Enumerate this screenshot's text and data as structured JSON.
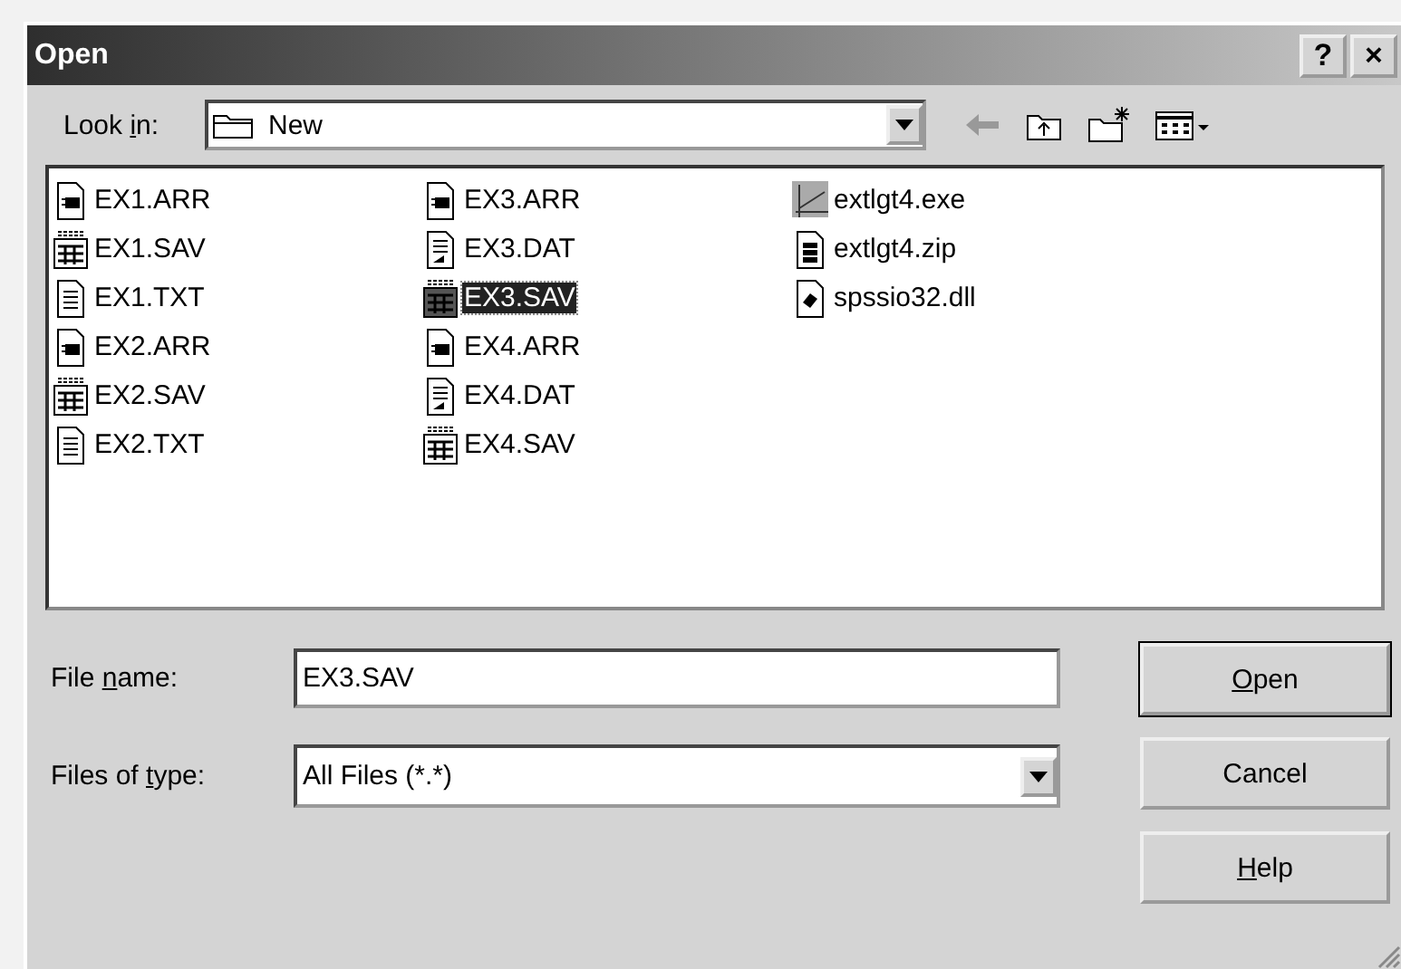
{
  "window": {
    "title": "Open",
    "help_glyph": "?",
    "close_glyph": "×"
  },
  "look_in": {
    "label": {
      "before": "Look ",
      "key": "i",
      "after": "n:"
    },
    "value": "New"
  },
  "files": [
    {
      "name": "EX1.ARR",
      "kind": "arr",
      "selected": false
    },
    {
      "name": "EX1.SAV",
      "kind": "sav",
      "selected": false
    },
    {
      "name": "EX1.TXT",
      "kind": "txt",
      "selected": false
    },
    {
      "name": "EX2.ARR",
      "kind": "arr",
      "selected": false
    },
    {
      "name": "EX2.SAV",
      "kind": "sav",
      "selected": false
    },
    {
      "name": "EX2.TXT",
      "kind": "txt",
      "selected": false
    },
    {
      "name": "EX3.ARR",
      "kind": "arr",
      "selected": false
    },
    {
      "name": "EX3.DAT",
      "kind": "dat",
      "selected": false
    },
    {
      "name": "EX3.SAV",
      "kind": "sav",
      "selected": true
    },
    {
      "name": "EX4.ARR",
      "kind": "arr",
      "selected": false
    },
    {
      "name": "EX4.DAT",
      "kind": "dat",
      "selected": false
    },
    {
      "name": "EX4.SAV",
      "kind": "sav",
      "selected": false
    },
    {
      "name": "extlgt4.exe",
      "kind": "exe",
      "selected": false
    },
    {
      "name": "extlgt4.zip",
      "kind": "zip",
      "selected": false
    },
    {
      "name": "spssio32.dll",
      "kind": "dll",
      "selected": false
    }
  ],
  "file_name": {
    "label": {
      "before": "File ",
      "key": "n",
      "after": "ame:"
    },
    "value": "EX3.SAV"
  },
  "file_type": {
    "label": {
      "before": "Files of ",
      "key": "t",
      "after": "ype:"
    },
    "value": "All Files (*.*)"
  },
  "buttons": [
    {
      "label": {
        "key": "O",
        "after": "pen"
      },
      "default": true
    },
    {
      "label": {
        "before": "Cancel"
      },
      "default": false
    },
    {
      "label": {
        "key": "H",
        "after": "elp"
      },
      "default": false
    }
  ]
}
